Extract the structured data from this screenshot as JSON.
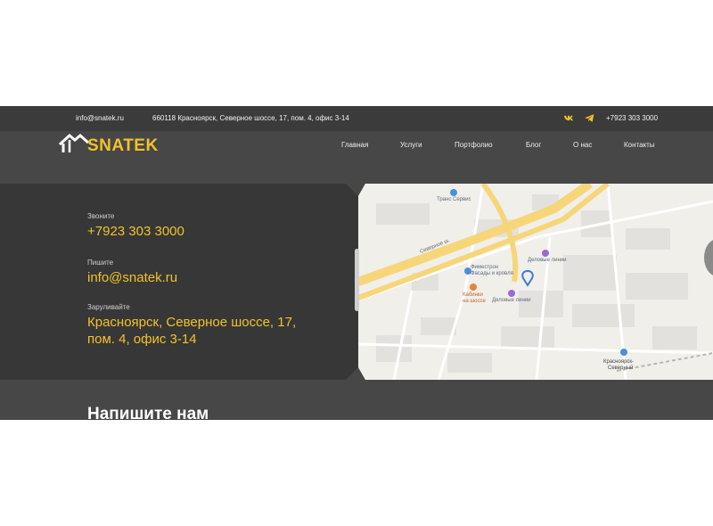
{
  "topbar": {
    "email": "info@snatek.ru",
    "address": "660118 Красноярск, Северное шоссе, 17, пом. 4, офис 3-14",
    "phone": "+7923 303 3000",
    "social_icons": [
      "vk-icon",
      "telegram-icon"
    ]
  },
  "header": {
    "logo_text": "SNATEK",
    "nav": [
      "Главная",
      "Услуги",
      "Портфолио",
      "Блог",
      "О нас",
      "Контакты"
    ]
  },
  "contacts": {
    "call_label": "Звоните",
    "phone": "+7923 303 3000",
    "write_label": "Пишите",
    "email": "info@snatek.ru",
    "visit_label": "Заруливайте",
    "address_line1": "Красноярск, Северное шоссе, 17,",
    "address_line2": "пом. 4, офис 3-14"
  },
  "map": {
    "labels": {
      "trans_service": "Транс Сервис",
      "road": "Северное ш.",
      "facades": "Фасады и кровля",
      "facades_top": "Фиместрон",
      "biz_lines_1": "Деловые линии",
      "biz_lines_2": "Деловые линии",
      "kabinki_1": "Кабинки",
      "kabinki_2": "на шоссе",
      "station_1": "Красноярск-",
      "station_2": "Северный"
    }
  },
  "section": {
    "title": "Напишите нам"
  },
  "colors": {
    "accent": "#f2c22a",
    "topbar_bg": "#3b3b3b",
    "page_bg": "#474747",
    "card_bg": "#373737"
  }
}
